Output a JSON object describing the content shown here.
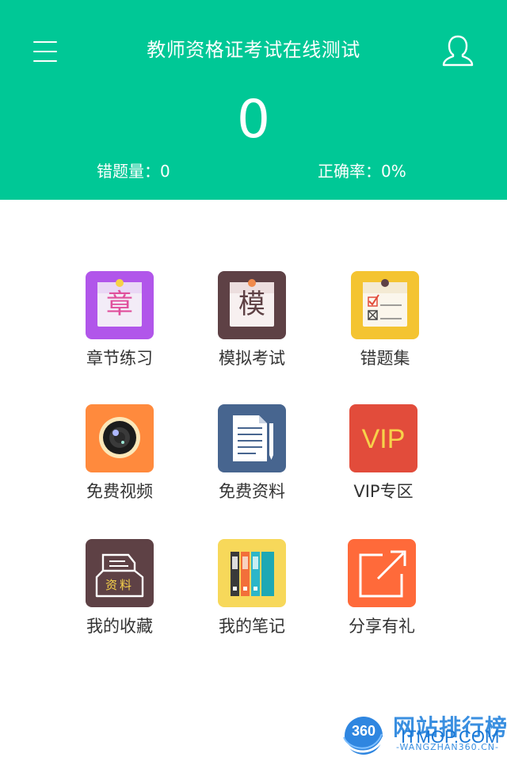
{
  "header": {
    "title": "教师资格证考试在线测试",
    "score": "0",
    "wrong_count": "错题量：0",
    "accuracy": "正确率：0%",
    "menu_icon": "menu-icon",
    "user_icon": "user-icon"
  },
  "colors": {
    "header_bg": "#00c896",
    "label_text": "#333333"
  },
  "grid": [
    {
      "label": "章节练习",
      "icon": "chapter-icon",
      "glyph": "章",
      "bg": "#b156ea"
    },
    {
      "label": "模拟考试",
      "icon": "mock-exam-icon",
      "glyph": "模",
      "bg": "#5e4145"
    },
    {
      "label": "错题集",
      "icon": "wrong-questions-icon",
      "bg": "#f4c431"
    },
    {
      "label": "免费视频",
      "icon": "video-camera-icon",
      "bg": "#ff8a3d"
    },
    {
      "label": "免费资料",
      "icon": "document-icon",
      "bg": "#47658f"
    },
    {
      "label": "VIP专区",
      "icon": "vip-icon",
      "glyph": "VIP",
      "bg": "#e24c3b"
    },
    {
      "label": "我的收藏",
      "icon": "favorites-icon",
      "glyph": "资料",
      "bg": "#5e4145"
    },
    {
      "label": "我的笔记",
      "icon": "notes-binders-icon",
      "bg": "#f7d85a"
    },
    {
      "label": "分享有礼",
      "icon": "share-icon",
      "bg": "#ff6a3a"
    }
  ],
  "watermark": {
    "title": "网站排行榜",
    "brand": "ITMOP.COM",
    "url": "-WANGZHAN360.CN-",
    "logo_text": "360"
  }
}
